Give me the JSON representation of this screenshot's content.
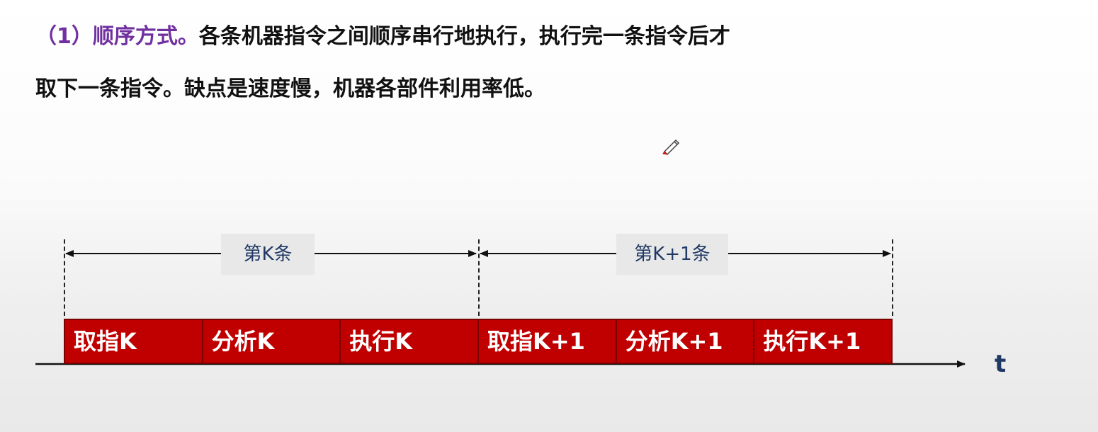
{
  "text": {
    "line1_heading": "（1）顺序方式。",
    "line1_body": "各条机器指令之间顺序串行地执行，执行完一条指令后才",
    "line2": "取下一条指令。缺点是速度慢，机器各部件利用率低。"
  },
  "diagram": {
    "spans": [
      {
        "label": "第K条"
      },
      {
        "label": "第K+1条"
      }
    ],
    "stages": [
      {
        "label": "取指K"
      },
      {
        "label": "分析K"
      },
      {
        "label": "执行K"
      },
      {
        "label": "取指K+1"
      },
      {
        "label": "分析K+1"
      },
      {
        "label": "执行K+1"
      }
    ],
    "axis_label": "t",
    "colors": {
      "stage_fill": "#c00000",
      "heading": "#7030a0",
      "label_text": "#1f3864"
    }
  }
}
